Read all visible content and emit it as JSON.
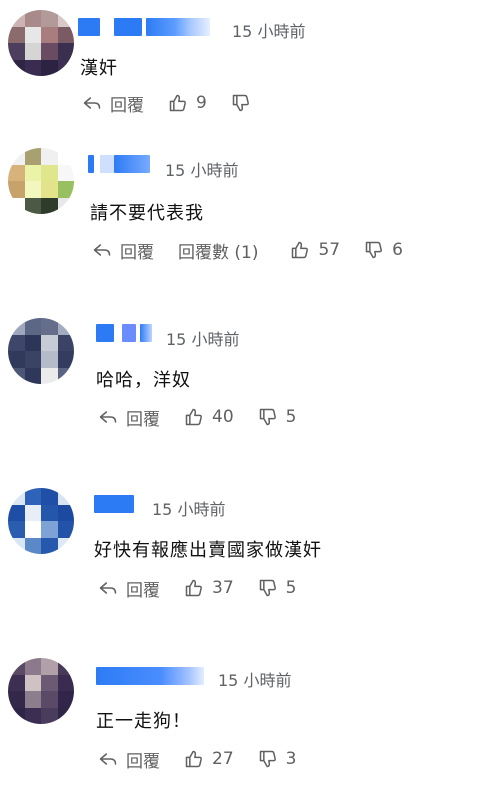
{
  "comments": [
    {
      "time": "15 小時前",
      "text": "漢奸",
      "reply": "回覆",
      "replies_label": "",
      "likes": "9",
      "dislikes": ""
    },
    {
      "time": "15 小時前",
      "text": "請不要代表我",
      "reply": "回覆",
      "replies_label": "回覆數 (1)",
      "likes": "57",
      "dislikes": "6"
    },
    {
      "time": "15 小時前",
      "text": "哈哈，洋奴",
      "reply": "回覆",
      "replies_label": "",
      "likes": "40",
      "dislikes": "5"
    },
    {
      "time": "15 小時前",
      "text": "好快有報應出賣國家做漢奸",
      "reply": "回覆",
      "replies_label": "",
      "likes": "37",
      "dislikes": "5"
    },
    {
      "time": "15 小時前",
      "text": "正一走狗！",
      "reply": "回覆",
      "replies_label": "",
      "likes": "27",
      "dislikes": "3"
    }
  ],
  "icons": {
    "reply": "reply-arrow-icon",
    "like": "thumbs-up-icon",
    "dislike": "thumbs-down-icon"
  },
  "colors": {
    "username": "#2d7bf4",
    "meta": "#606060"
  }
}
